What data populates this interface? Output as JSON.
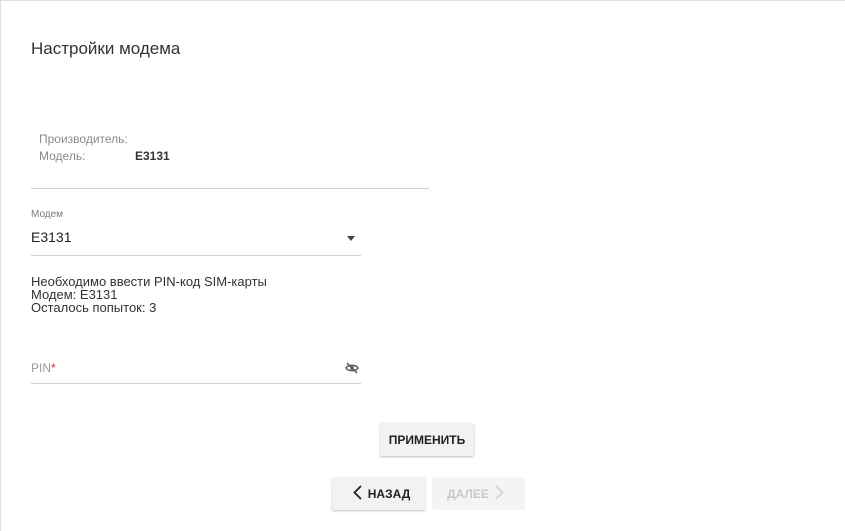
{
  "page": {
    "title": "Настройки модема"
  },
  "info": {
    "manufacturer_label": "Производитель:",
    "manufacturer_value": "",
    "model_label": "Модель:",
    "model_value": "E3131"
  },
  "modem_select": {
    "label": "Модем",
    "value": "E3131"
  },
  "pin_note": {
    "line1": "Необходимо ввести PIN-код SIM-карты",
    "line2": "Модем: E3131",
    "line3": "Осталось попыток: 3"
  },
  "pin_field": {
    "label": "PIN",
    "required_mark": "*",
    "visibility_icon": "eye-off-icon"
  },
  "buttons": {
    "apply": "ПРИМЕНИТЬ",
    "back": "НАЗАД",
    "next": "ДАЛЕЕ"
  }
}
